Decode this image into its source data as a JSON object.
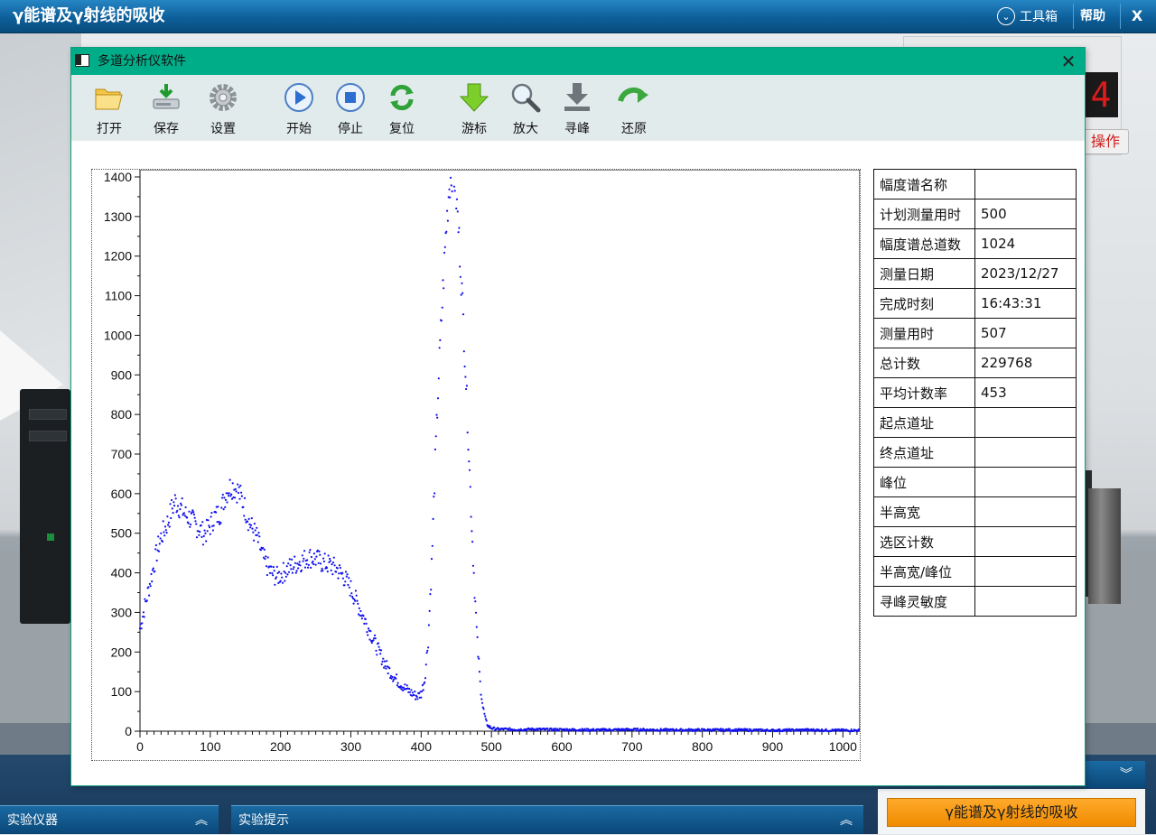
{
  "app_bar": {
    "title": "γ能谱及γ射线的吸收",
    "toolbox_label": "工具箱",
    "help_label": "帮助",
    "close_label": "X"
  },
  "scene": {
    "led_digit": "4",
    "device_button_label": "操作"
  },
  "window": {
    "title": "多道分析仪软件",
    "close_label": "✕"
  },
  "toolbar": {
    "open": "打开",
    "save": "保存",
    "settings": "设置",
    "start": "开始",
    "stop": "停止",
    "reset": "复位",
    "cursor": "游标",
    "zoom": "放大",
    "find_peak": "寻峰",
    "restore": "还原"
  },
  "info_table": [
    {
      "key": "幅度谱名称",
      "value": ""
    },
    {
      "key": "计划测量用时",
      "value": "500"
    },
    {
      "key": "幅度谱总道数",
      "value": "1024"
    },
    {
      "key": "测量日期",
      "value": "2023/12/27"
    },
    {
      "key": "完成时刻",
      "value": "16:43:31"
    },
    {
      "key": "测量用时",
      "value": "507"
    },
    {
      "key": "总计数",
      "value": "229768"
    },
    {
      "key": "平均计数率",
      "value": "453"
    },
    {
      "key": "起点道址",
      "value": ""
    },
    {
      "key": "终点道址",
      "value": ""
    },
    {
      "key": "峰位",
      "value": ""
    },
    {
      "key": "半高宽",
      "value": ""
    },
    {
      "key": "选区计数",
      "value": ""
    },
    {
      "key": "半高宽/峰位",
      "value": ""
    },
    {
      "key": "寻峰灵敏度",
      "value": ""
    }
  ],
  "bottom_bar": {
    "instruments": "实验仪器",
    "hints": "实验提示",
    "experiment_title": "γ能谱及γ射线的吸收"
  },
  "colors": {
    "window_title": "#00ad89",
    "point_color": "#1111ee",
    "app_bar": "#0d5f9a",
    "badge": "#f7a11f"
  },
  "chart_data": {
    "type": "scatter",
    "title": "",
    "xlabel": "",
    "ylabel": "",
    "xlim": [
      0,
      1024
    ],
    "ylim": [
      0,
      1400
    ],
    "x_ticks": [
      0,
      100,
      200,
      300,
      400,
      500,
      600,
      700,
      800,
      900,
      1000
    ],
    "y_ticks": [
      0,
      100,
      200,
      300,
      400,
      500,
      600,
      700,
      800,
      900,
      1000,
      1100,
      1200,
      1300,
      1400
    ],
    "grid": false,
    "series": [
      {
        "name": "",
        "x": [
          0,
          5,
          10,
          15,
          20,
          25,
          30,
          35,
          40,
          45,
          50,
          55,
          60,
          65,
          70,
          75,
          80,
          85,
          90,
          95,
          100,
          105,
          110,
          115,
          120,
          125,
          130,
          135,
          140,
          145,
          150,
          155,
          160,
          165,
          170,
          175,
          180,
          185,
          190,
          195,
          200,
          210,
          220,
          230,
          240,
          250,
          260,
          270,
          280,
          290,
          300,
          310,
          320,
          330,
          340,
          350,
          360,
          370,
          380,
          385,
          390,
          395,
          400,
          405,
          410,
          415,
          420,
          425,
          430,
          435,
          440,
          445,
          448,
          452,
          456,
          460,
          464,
          468,
          472,
          476,
          480,
          484,
          488,
          492,
          496,
          500,
          505,
          510,
          520,
          540,
          560,
          580,
          600,
          650,
          700,
          750,
          800,
          850,
          900,
          950,
          1000,
          1024
        ],
        "y": [
          260,
          300,
          340,
          380,
          420,
          460,
          490,
          510,
          530,
          560,
          580,
          570,
          560,
          545,
          540,
          530,
          520,
          510,
          500,
          505,
          520,
          540,
          545,
          555,
          590,
          610,
          620,
          615,
          605,
          585,
          560,
          530,
          510,
          495,
          470,
          440,
          420,
          405,
          395,
          390,
          395,
          410,
          420,
          430,
          440,
          435,
          425,
          420,
          410,
          390,
          360,
          320,
          280,
          240,
          200,
          165,
          140,
          120,
          105,
          98,
          92,
          88,
          95,
          130,
          230,
          420,
          680,
          900,
          1080,
          1250,
          1380,
          1420,
          1390,
          1300,
          1180,
          1040,
          880,
          700,
          520,
          360,
          220,
          120,
          60,
          25,
          12,
          8,
          6,
          5,
          5,
          4,
          5,
          4,
          4,
          3,
          4,
          3,
          3,
          3,
          2,
          3,
          2,
          2
        ]
      }
    ]
  }
}
